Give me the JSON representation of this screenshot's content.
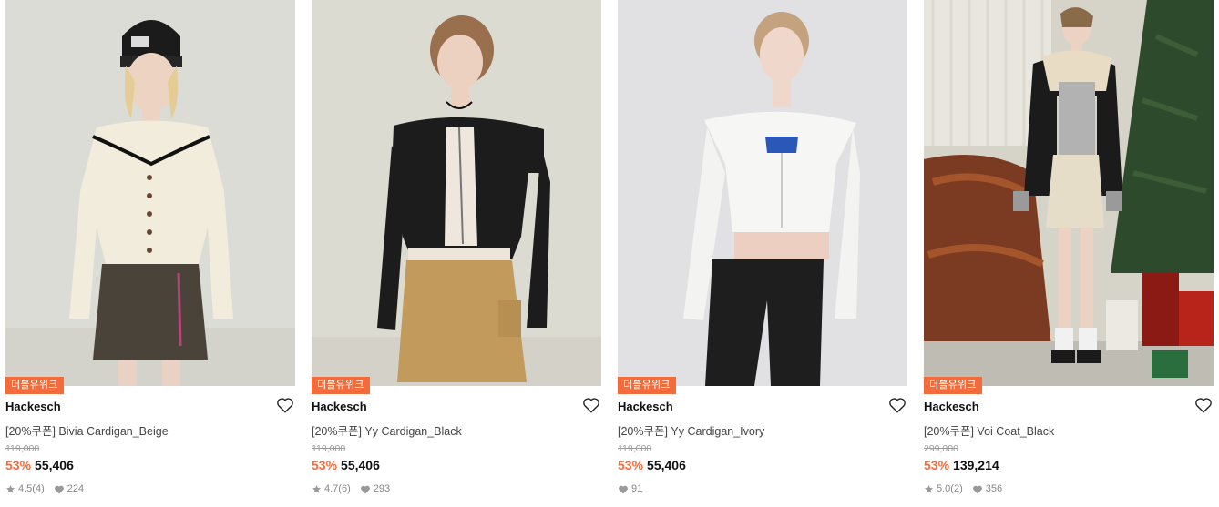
{
  "accent_color": "#f36b3a",
  "products": [
    {
      "badge": "더블유위크",
      "brand": "Hackesch",
      "name": "[20%쿠폰] Bivia Cardigan_Beige",
      "original_price": "119,000",
      "discount": "53%",
      "price": "55,406",
      "rating": "4.5",
      "review_count": "(4)",
      "likes": "224",
      "image_description": "model in black beanie, beige cardigan, brown pleated skirt"
    },
    {
      "badge": "더블유위크",
      "brand": "Hackesch",
      "name": "[20%쿠폰] Yy Cardigan_Black",
      "original_price": "119,000",
      "discount": "53%",
      "price": "55,406",
      "rating": "4.7",
      "review_count": "(6)",
      "likes": "293",
      "image_description": "model in black off-shoulder cardigan, camel pleated skirt"
    },
    {
      "badge": "더블유위크",
      "brand": "Hackesch",
      "name": "[20%쿠폰] Yy Cardigan_Ivory",
      "original_price": "119,000",
      "discount": "53%",
      "price": "55,406",
      "likes": "91",
      "image_description": "model in ivory off-shoulder cardigan, black cargo pants"
    },
    {
      "badge": "더블유위크",
      "brand": "Hackesch",
      "name": "[20%쿠폰] Voi Coat_Black",
      "original_price": "299,000",
      "discount": "53%",
      "price": "139,214",
      "rating": "5.0",
      "review_count": "(2)",
      "likes": "356",
      "image_description": "model in black shearling coat in room with christmas tree"
    }
  ]
}
